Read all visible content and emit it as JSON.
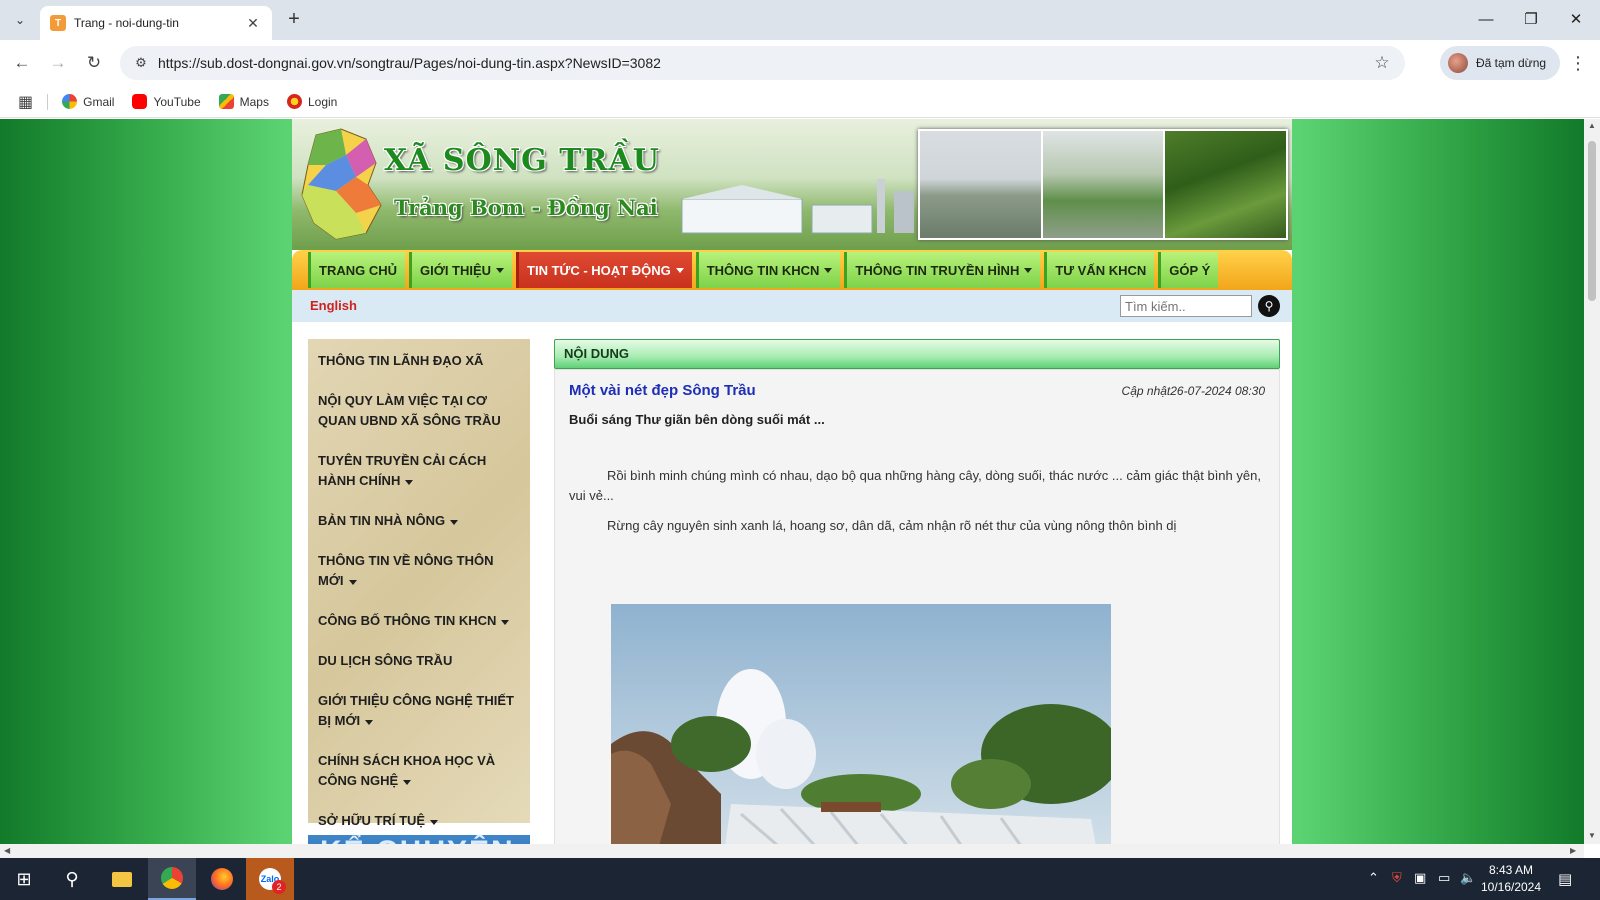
{
  "browser": {
    "tab_title": "Trang - noi-dung-tin",
    "tab_favicon_letter": "T",
    "url": "https://sub.dost-dongnai.gov.vn/songtrau/Pages/noi-dung-tin.aspx?NewsID=3082",
    "profile_label": "Đã tạm dừng",
    "bookmarks": [
      "Gmail",
      "YouTube",
      "Maps",
      "Login"
    ]
  },
  "site": {
    "banner_title": "XÃ SÔNG TRẦU",
    "banner_subtitle": "Trảng Bom - Đồng Nai",
    "nav": [
      {
        "label": "TRANG CHỦ",
        "dropdown": false,
        "active": false
      },
      {
        "label": "GIỚI THIỆU",
        "dropdown": true,
        "active": false
      },
      {
        "label": "TIN TỨC - HOẠT ĐỘNG",
        "dropdown": true,
        "active": true
      },
      {
        "label": "THÔNG TIN KHCN",
        "dropdown": true,
        "active": false
      },
      {
        "label": "THÔNG TIN TRUYỀN HÌNH",
        "dropdown": true,
        "active": false
      },
      {
        "label": "TƯ VẤN KHCN",
        "dropdown": false,
        "active": false
      },
      {
        "label": "GÓP Ý",
        "dropdown": false,
        "active": false
      }
    ],
    "english_link": "English",
    "search_placeholder": "Tìm kiếm..",
    "sidebar": [
      {
        "label": "THÔNG TIN LÃNH ĐẠO XÃ",
        "dropdown": false
      },
      {
        "label": "NỘI QUY LÀM VIỆC TẠI CƠ QUAN UBND XÃ SÔNG TRẦU",
        "dropdown": false
      },
      {
        "label": "TUYÊN TRUYỀN CẢI CÁCH HÀNH CHÍNH",
        "dropdown": true
      },
      {
        "label": "BẢN TIN NHÀ NÔNG",
        "dropdown": true
      },
      {
        "label": "THÔNG TIN VỀ NÔNG THÔN MỚI",
        "dropdown": true
      },
      {
        "label": "CÔNG BỐ THÔNG TIN KHCN",
        "dropdown": true
      },
      {
        "label": "DU LỊCH SÔNG TRẦU",
        "dropdown": false
      },
      {
        "label": "GIỚI THIỆU CÔNG NGHỆ THIẾT BỊ MỚI",
        "dropdown": true
      },
      {
        "label": "CHÍNH SÁCH KHOA HỌC VÀ CÔNG NGHỆ",
        "dropdown": true
      },
      {
        "label": "SỞ HỮU TRÍ TUỆ",
        "dropdown": true
      }
    ],
    "side_banner_text": "KỂ CHUYỆN"
  },
  "article": {
    "section_header": "NỘI DUNG",
    "title": "Một vài nét đẹp Sông Trầu",
    "updated": "Cập nhật26-07-2024 08:30",
    "lead": "Buổi sáng Thư giãn bên dòng suối mát ...",
    "paragraphs": [
      "Rồi bình minh chúng mình có nhau, dạo bộ qua những hàng cây, dòng suối, thác nước ... cảm giác thật bình yên, vui vẻ...",
      "Rừng cây nguyên sinh xanh lá, hoang sơ, dân dã, cảm nhận rõ nét thư của vùng nông thôn bình dị"
    ]
  },
  "taskbar": {
    "time": "8:43 AM",
    "date": "10/16/2024",
    "zalo_badge": "2"
  }
}
